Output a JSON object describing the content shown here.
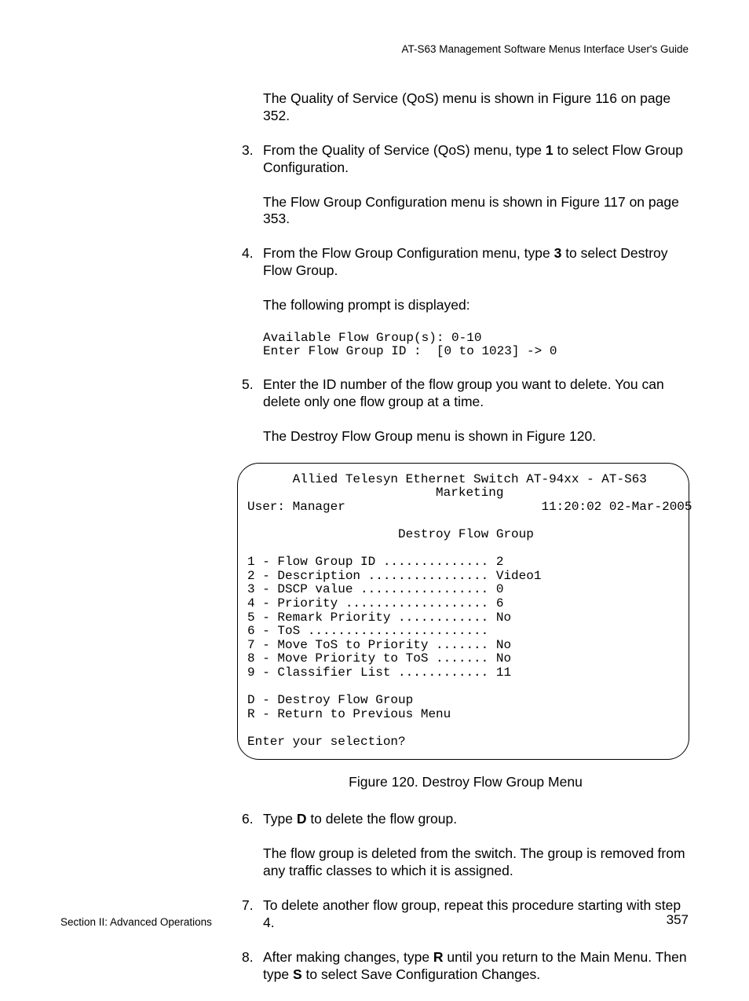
{
  "running_head": "AT-S63 Management Software Menus Interface User's Guide",
  "intro_para": "The Quality of Service (QoS) menu is shown in Figure 116 on page 352.",
  "steps": {
    "s3": {
      "num": "3.",
      "p1a": "From the Quality of Service (QoS) menu, type ",
      "p1b": "1",
      "p1c": " to select Flow Group Configuration.",
      "p2": "The Flow Group Configuration menu is shown in Figure 117 on page 353."
    },
    "s4": {
      "num": "4.",
      "p1a": "From the Flow Group Configuration menu, type ",
      "p1b": "3",
      "p1c": " to select Destroy Flow Group.",
      "p2": "The following prompt is displayed:",
      "code": "Available Flow Group(s): 0-10\nEnter Flow Group ID :  [0 to 1023] -> 0"
    },
    "s5": {
      "num": "5.",
      "p1": "Enter the ID number of the flow group you want to delete. You can delete only one flow group at a time.",
      "p2": "The Destroy Flow Group menu is shown in Figure 120."
    },
    "s6": {
      "num": "6.",
      "p1a": "Type ",
      "p1b": "D",
      "p1c": " to delete the flow group.",
      "p2": "The flow group is deleted from the switch. The group is removed from any traffic classes to which it is assigned."
    },
    "s7": {
      "num": "7.",
      "p1": "To delete another flow group, repeat this procedure starting with step 4."
    },
    "s8": {
      "num": "8.",
      "p1a": "After making changes, type ",
      "p1b": "R",
      "p1c": " until you return to the Main Menu. Then type ",
      "p1d": "S",
      "p1e": " to select Save Configuration Changes."
    }
  },
  "terminal": "      Allied Telesyn Ethernet Switch AT-94xx - AT-S63\n                         Marketing\nUser: Manager                          11:20:02 02-Mar-2005\n\n                    Destroy Flow Group\n\n1 - Flow Group ID .............. 2\n2 - Description ................ Video1\n3 - DSCP value ................. 0\n4 - Priority ................... 6\n5 - Remark Priority ............ No\n6 - ToS ........................\n7 - Move ToS to Priority ....... No\n8 - Move Priority to ToS ....... No\n9 - Classifier List ............ 11\n\nD - Destroy Flow Group\nR - Return to Previous Menu\n\nEnter your selection?",
  "caption": "Figure 120. Destroy Flow Group Menu",
  "footer_left": "Section II: Advanced Operations",
  "footer_right": "357"
}
